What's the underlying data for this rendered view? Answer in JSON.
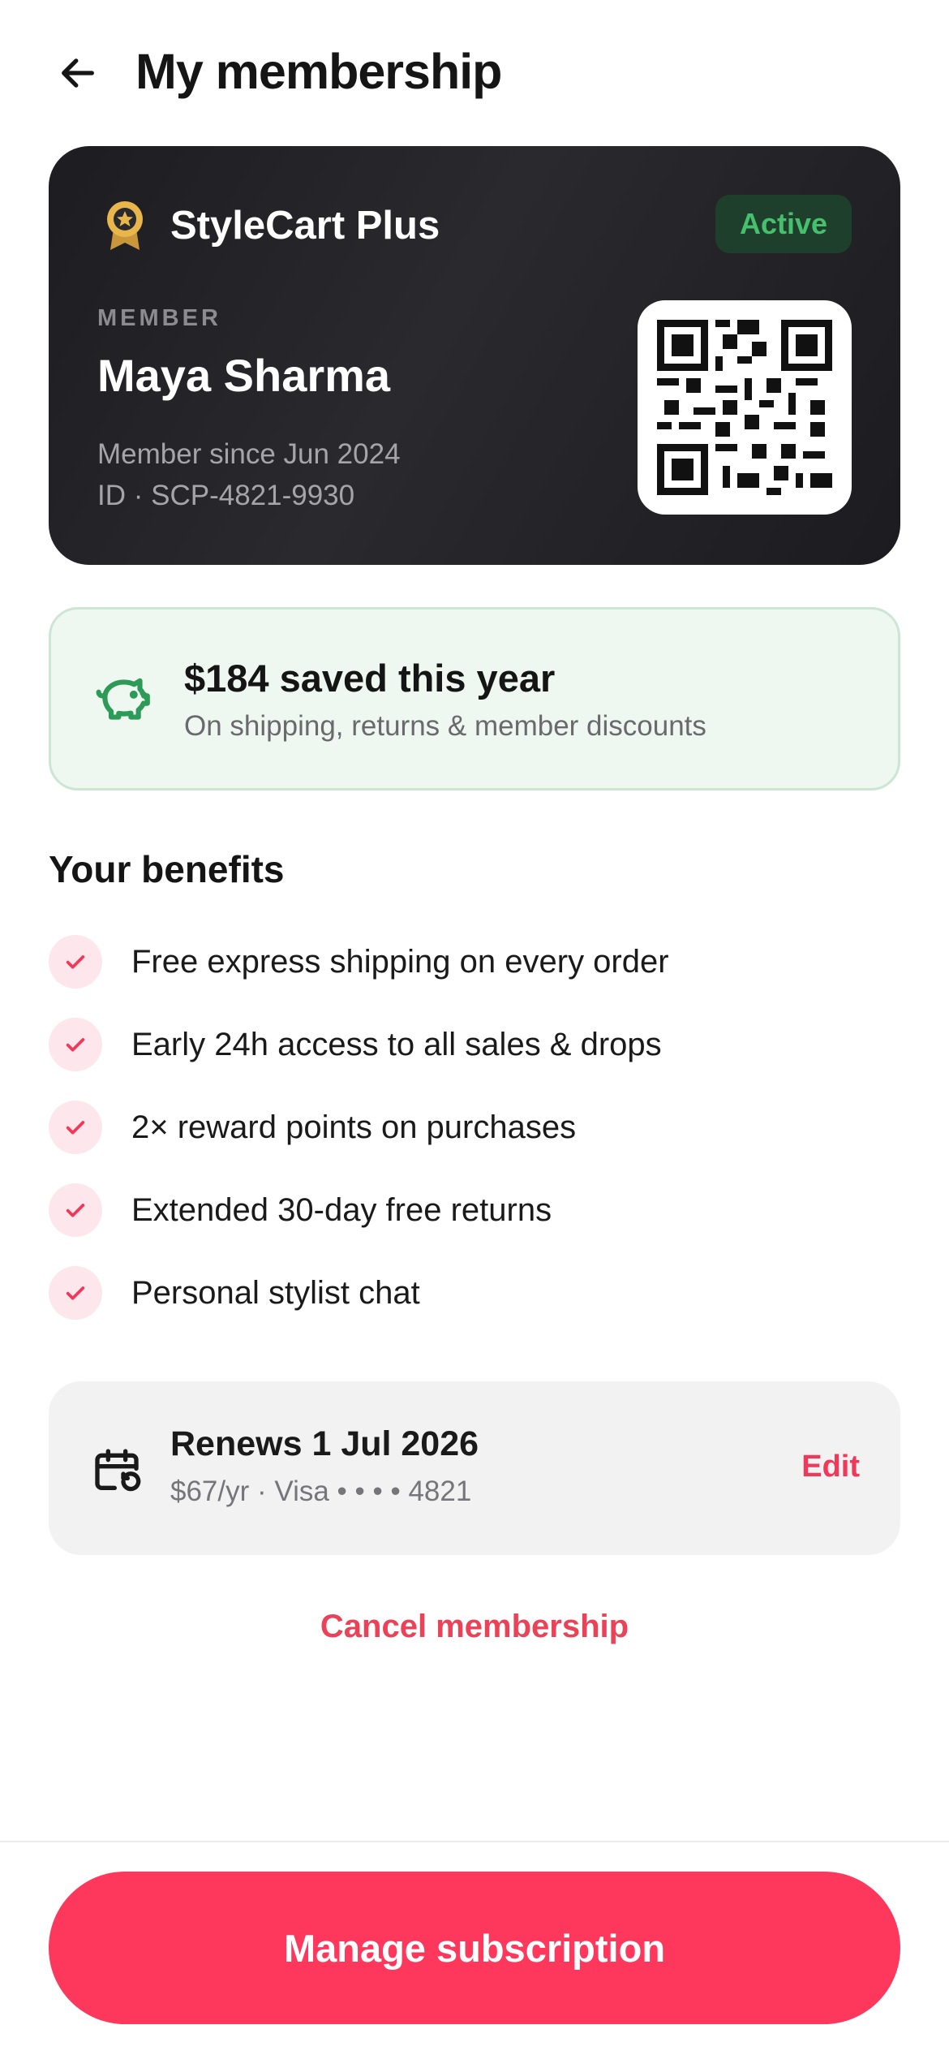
{
  "header": {
    "title": "My membership",
    "back_icon": "arrow-left-icon"
  },
  "card": {
    "brand": "StyleCart Plus",
    "status": "Active",
    "member_label": "MEMBER",
    "member_name": "Maya Sharma",
    "member_since": "Member since Jun 2024",
    "member_id": "ID · SCP-4821-9930",
    "colors": {
      "background": "#1d1d21",
      "status_text": "#46c06c",
      "status_bg": "#1e3f2b",
      "badge": "#e9b64c"
    }
  },
  "savings": {
    "title": "$184 saved this year",
    "subtitle": "On shipping, returns & member discounts",
    "icon": "piggy-bank-icon",
    "accent": "#2e9a58"
  },
  "benefits": {
    "heading": "Your benefits",
    "items": [
      {
        "label": "Free express shipping on every order"
      },
      {
        "label": "Early 24h access to all sales & drops"
      },
      {
        "label": "2× reward points on purchases"
      },
      {
        "label": "Extended 30-day free returns"
      },
      {
        "label": "Personal stylist chat"
      }
    ]
  },
  "renewal": {
    "title": "Renews 1 Jul 2026",
    "subtitle": "$67/yr · Visa • • • • 4821",
    "edit_label": "Edit",
    "icon": "calendar-repeat-icon"
  },
  "actions": {
    "cancel_label": "Cancel membership",
    "manage_label": "Manage subscription",
    "primary_color": "#fe385c"
  }
}
